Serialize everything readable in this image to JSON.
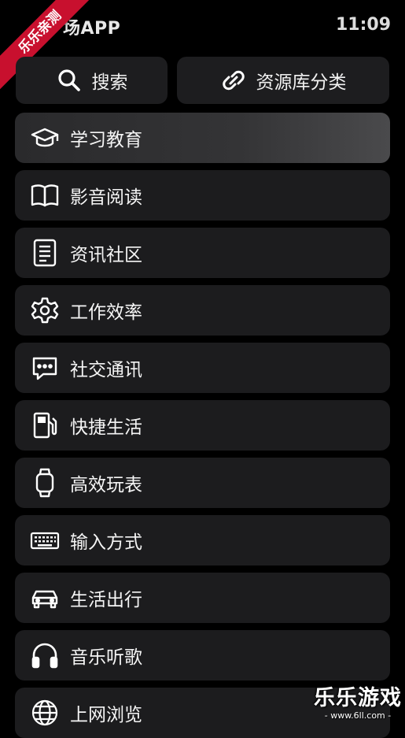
{
  "status_bar": {
    "app_title": "场APP",
    "time": "11:09"
  },
  "ribbon": {
    "text": "乐乐亲测"
  },
  "top_buttons": {
    "search": {
      "label": "搜索",
      "icon": "search-icon"
    },
    "library": {
      "label": "资源库分类",
      "icon": "link-icon"
    }
  },
  "categories": [
    {
      "label": "学习教育",
      "icon": "graduation-cap-icon",
      "active": true
    },
    {
      "label": "影音阅读",
      "icon": "book-icon"
    },
    {
      "label": "资讯社区",
      "icon": "news-icon"
    },
    {
      "label": "工作效率",
      "icon": "gear-icon"
    },
    {
      "label": "社交通讯",
      "icon": "chat-icon"
    },
    {
      "label": "快捷生活",
      "icon": "fuel-pump-icon"
    },
    {
      "label": "高效玩表",
      "icon": "watch-icon"
    },
    {
      "label": "输入方式",
      "icon": "keyboard-icon"
    },
    {
      "label": "生活出行",
      "icon": "car-icon"
    },
    {
      "label": "音乐听歌",
      "icon": "headphones-icon"
    },
    {
      "label": "上网浏览",
      "icon": "globe-icon"
    }
  ],
  "watermark": {
    "main": "乐乐游戏",
    "sub": "- www.6ll.com -"
  },
  "colors": {
    "background": "#000000",
    "card": "#1c1c1e",
    "ribbon": "#c8102e"
  }
}
